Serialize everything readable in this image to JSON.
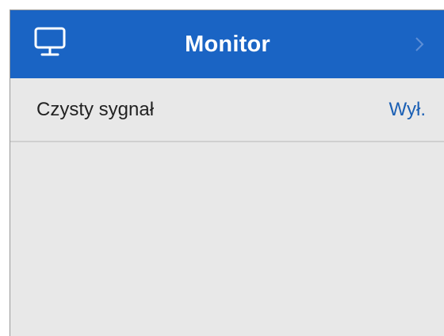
{
  "header": {
    "title": "Monitor",
    "icon": "monitor-icon",
    "nav_icon": "chevron-right-icon",
    "color": "#1a64c4"
  },
  "settings": {
    "rows": [
      {
        "label": "Czysty sygnał",
        "value": "Wył."
      }
    ]
  },
  "colors": {
    "panel_background": "#e8e8e8",
    "value_text": "#1a5fb4",
    "label_text": "#222222"
  }
}
